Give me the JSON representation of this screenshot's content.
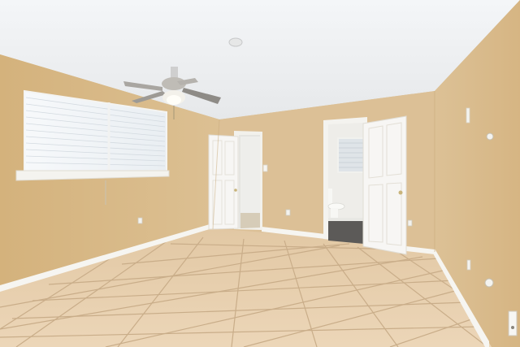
{
  "scene": {
    "subject": "empty-bedroom-interior",
    "elements": [
      "ceiling",
      "left-wall",
      "back-wall",
      "right-wall",
      "window-with-blinds",
      "ceiling-fan",
      "closet-door",
      "bathroom-door",
      "toilet",
      "bathroom-window",
      "tile-floor",
      "baseboards",
      "outlets",
      "light-switch",
      "smoke-detector"
    ]
  },
  "colors": {
    "ceiling": "#eef0f2",
    "left_wall": "#d8b983",
    "back_wall": "#dcc096",
    "right_wall": "#dcbd8e",
    "floor_tile": "#e8cfaf",
    "grout": "#c8ad8a",
    "trim": "#f6f5f1",
    "door": "#f7f6f4",
    "bath_wall": "#eeede9"
  }
}
